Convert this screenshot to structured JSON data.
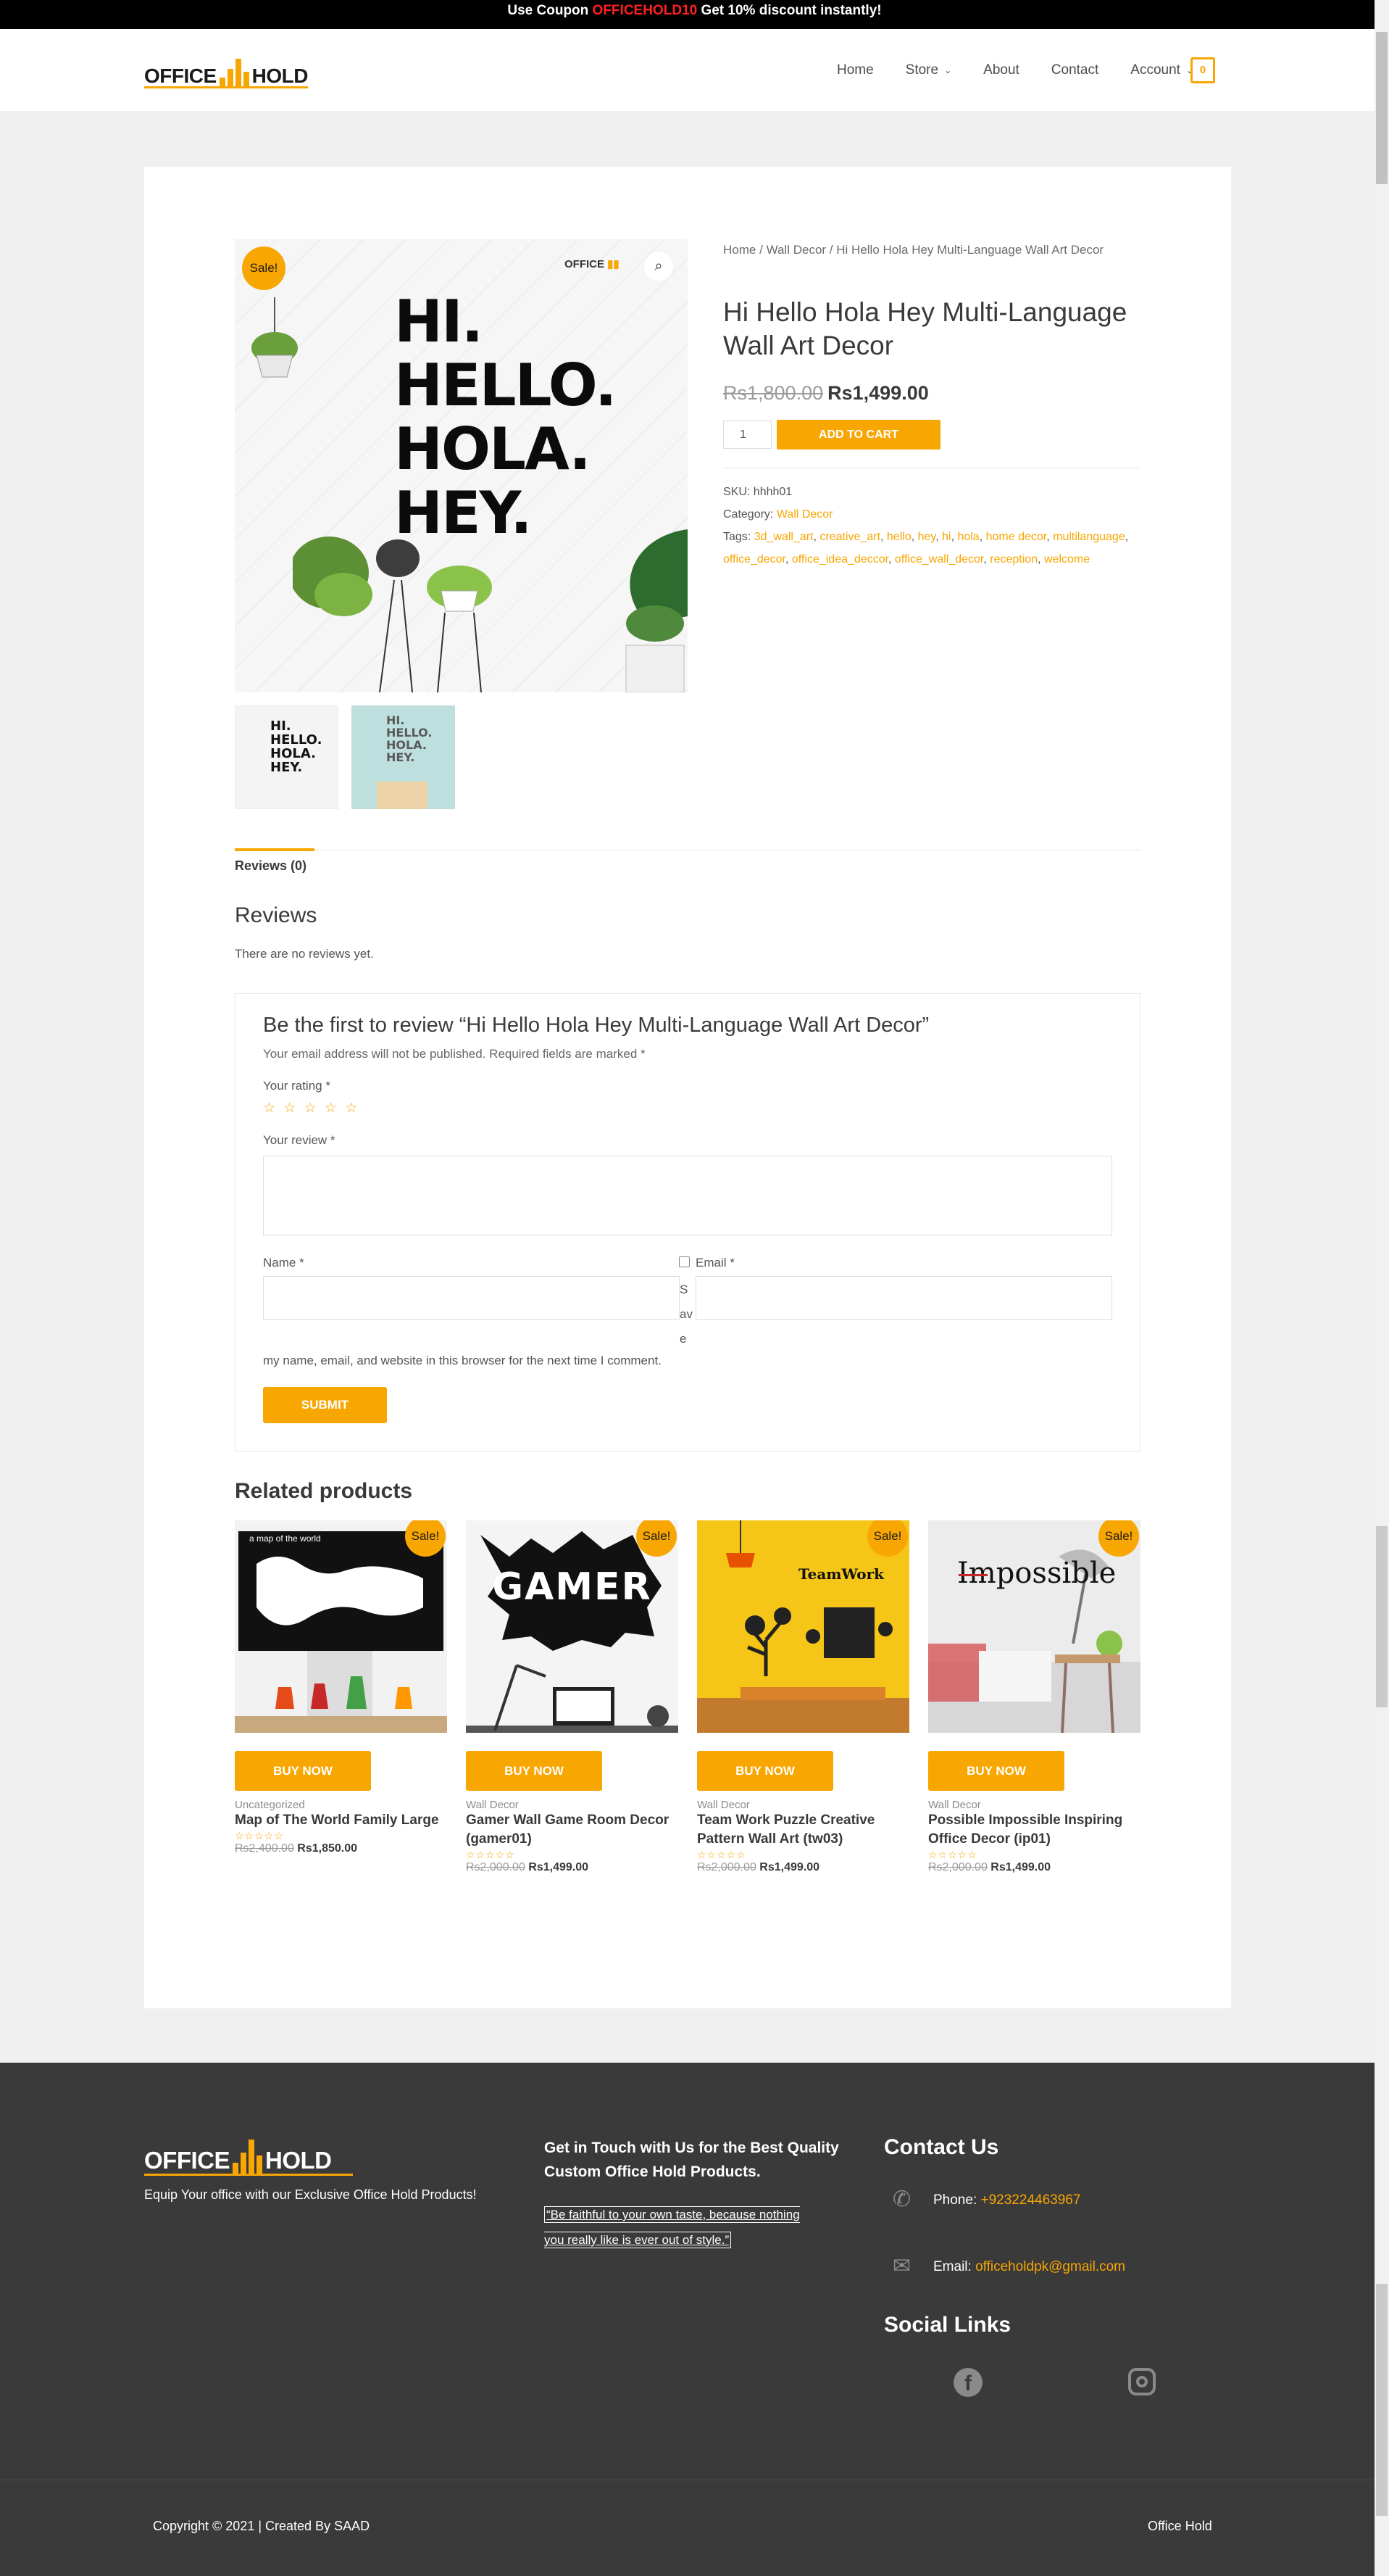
{
  "promo": {
    "prefix": "Use Coupon",
    "code": "OFFICEHOLD10",
    "suffix": "Get 10% discount instantly!"
  },
  "brand": {
    "left": "OFFICE",
    "right": "HOLD",
    "accent": "#f8a602"
  },
  "nav": {
    "home": "Home",
    "store": "Store",
    "about": "About",
    "contact": "Contact",
    "account": "Account",
    "cart_count": "0"
  },
  "breadcrumb": {
    "home": "Home",
    "sep1": "/",
    "cat": "Wall Decor",
    "sep2": "/",
    "current": "Hi Hello Hola Hey Multi-Language Wall Art Decor"
  },
  "product": {
    "title": "Hi Hello Hola Hey Multi-Language Wall Art Decor",
    "old_price": "Rs1,800.00",
    "price": "Rs1,499.00",
    "qty": "1",
    "add_to_cart": "ADD TO CART",
    "sale_badge": "Sale!",
    "image_text": [
      "HI.",
      "HELLO.",
      "HOLA.",
      "HEY."
    ],
    "sku_label": "SKU:",
    "sku": "hhhh01",
    "category_label": "Category:",
    "category": "Wall Decor",
    "tags_label": "Tags:",
    "tags": [
      "3d_wall_art",
      "creative_art",
      "hello",
      "hey",
      "hi",
      "hola",
      "home decor",
      "multilanguage",
      "office_decor",
      "office_idea_deccor",
      "office_wall_decor",
      "reception",
      "welcome"
    ]
  },
  "tabs": {
    "reviews": "Reviews (0)"
  },
  "reviews": {
    "heading": "Reviews",
    "none": "There are no reviews yet.",
    "form_title": "Be the first to review “Hi Hello Hola Hey Multi-Language Wall Art Decor”",
    "note": "Your email address will not be published. Required fields are marked *",
    "rating_label": "Your rating *",
    "stars": "☆ ☆ ☆ ☆ ☆",
    "review_label": "Your review *",
    "name_label": "Name *",
    "email_label": "Email *",
    "save_fragment": [
      "S",
      "av",
      "e"
    ],
    "save_rest": "my name, email, and website in this browser for the next time I comment.",
    "submit": "SUBMIT"
  },
  "related": {
    "heading": "Related products",
    "buy_label": "BUY NOW",
    "sale_badge": "Sale!",
    "items": [
      {
        "category": "Uncategorized",
        "name": "Map of The World Family Large",
        "old_price": "Rs2,400.00",
        "price": "Rs1,850.00",
        "stars": "☆☆☆☆☆"
      },
      {
        "category": "Wall Decor",
        "name": "Gamer Wall Game Room Decor (gamer01)",
        "old_price": "Rs2,000.00",
        "price": "Rs1,499.00",
        "stars": "☆☆☆☆☆"
      },
      {
        "category": "Wall Decor",
        "name": "Team Work Puzzle Creative Pattern Wall Art (tw03)",
        "old_price": "Rs2,000.00",
        "price": "Rs1,499.00",
        "stars": "☆☆☆☆☆"
      },
      {
        "category": "Wall Decor",
        "name": "Possible Impossible Inspiring Office Decor (ip01)",
        "old_price": "Rs2,000.00",
        "price": "Rs1,499.00",
        "stars": "☆☆☆☆☆"
      }
    ],
    "image_text": {
      "map": "a map of the world",
      "gamer": "GAMER",
      "teamwork": "TeamWork",
      "impossible": "Impossible"
    }
  },
  "footer": {
    "tagline": "Equip Your office with our Exclusive Office Hold Products!",
    "get_in_touch": "Get in Touch with Us for the Best Quality Custom Office Hold Products.",
    "quote": "“Be faithful to your own taste, because nothing you really like is ever out of style.”",
    "contact_heading": "Contact Us",
    "phone_label": "Phone:",
    "phone": "+923224463967",
    "email_label": "Email:",
    "email": "officeholdpk@gmail.com",
    "social_heading": "Social Links",
    "copyright": "Copyright © 2021 | Created By SAAD",
    "right_text": "Office Hold"
  }
}
